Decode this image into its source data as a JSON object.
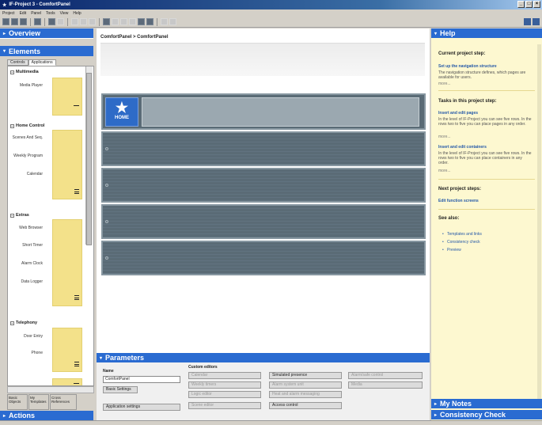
{
  "window": {
    "title": "IF-Project 3 - ComfortPanel"
  },
  "menu": [
    "Project",
    "Edit",
    "Panel",
    "Tools",
    "View",
    "Help"
  ],
  "left": {
    "overview": "Overview",
    "elements": "Elements",
    "tabs": [
      "Controls",
      "Applications"
    ],
    "sections": [
      {
        "title": "Multimedia",
        "items": [
          "Media Player"
        ]
      },
      {
        "title": "Home Control",
        "items": [
          "Scenes And Seq.",
          "Weekly Program",
          "Calendar"
        ]
      },
      {
        "title": "Extras",
        "items": [
          "Web Browser",
          "Short Timer",
          "Alarm Clock",
          "Data Logger"
        ]
      },
      {
        "title": "Telephony",
        "items": [
          "Door Entry",
          "Phone"
        ]
      }
    ],
    "bottom_tabs": [
      "Basic Objects",
      "My Templates",
      "Cross References"
    ],
    "actions": "Actions"
  },
  "center": {
    "breadcrumb": "ComfortPanel > ComfortPanel",
    "home": "HOME"
  },
  "params": {
    "title": "Parameters",
    "name_label": "Name",
    "name_value": "ComfortPanel",
    "basic_settings": "Basic Settings",
    "app_settings": "Application settings",
    "custom_editors": "Custom editors",
    "editors": [
      {
        "label": "Calendar",
        "enabled": false
      },
      {
        "label": "Simulated presence",
        "enabled": true
      },
      {
        "label": "Alarm/safe control",
        "enabled": false
      },
      {
        "label": "Weekly timers",
        "enabled": false
      },
      {
        "label": "Alarm system unit",
        "enabled": false
      },
      {
        "label": "Media",
        "enabled": false
      },
      {
        "label": "Logic editor",
        "enabled": false
      },
      {
        "label": "Heat and alarm messaging",
        "enabled": false
      },
      {
        "label": "Scene editor",
        "enabled": false
      },
      {
        "label": "Access control",
        "enabled": true
      }
    ]
  },
  "help": {
    "title": "Help",
    "current_step": "Current project step:",
    "nav_link": "Set up the navigation structure",
    "nav_text": "The navigation structure defines, which pages are available for users.",
    "more": "more...",
    "tasks_title": "Tasks in this project step:",
    "task1_link": "Insert and edit pages",
    "task1_text": "In the level of IF-Project you can see five rows. In the rows two to five you can place pages in any order.",
    "task2_link": "Insert and edit containers",
    "task2_text": "In the level of IF-Project you can see five rows. In the rows two to five you can place containers in any order.",
    "next_title": "Next project steps:",
    "next_link": "Edit function screens",
    "see_also": "See also:",
    "see_links": [
      "Templates and links",
      "Consistency check",
      "Preview"
    ],
    "my_notes": "My Notes",
    "consistency": "Consistency Check"
  }
}
